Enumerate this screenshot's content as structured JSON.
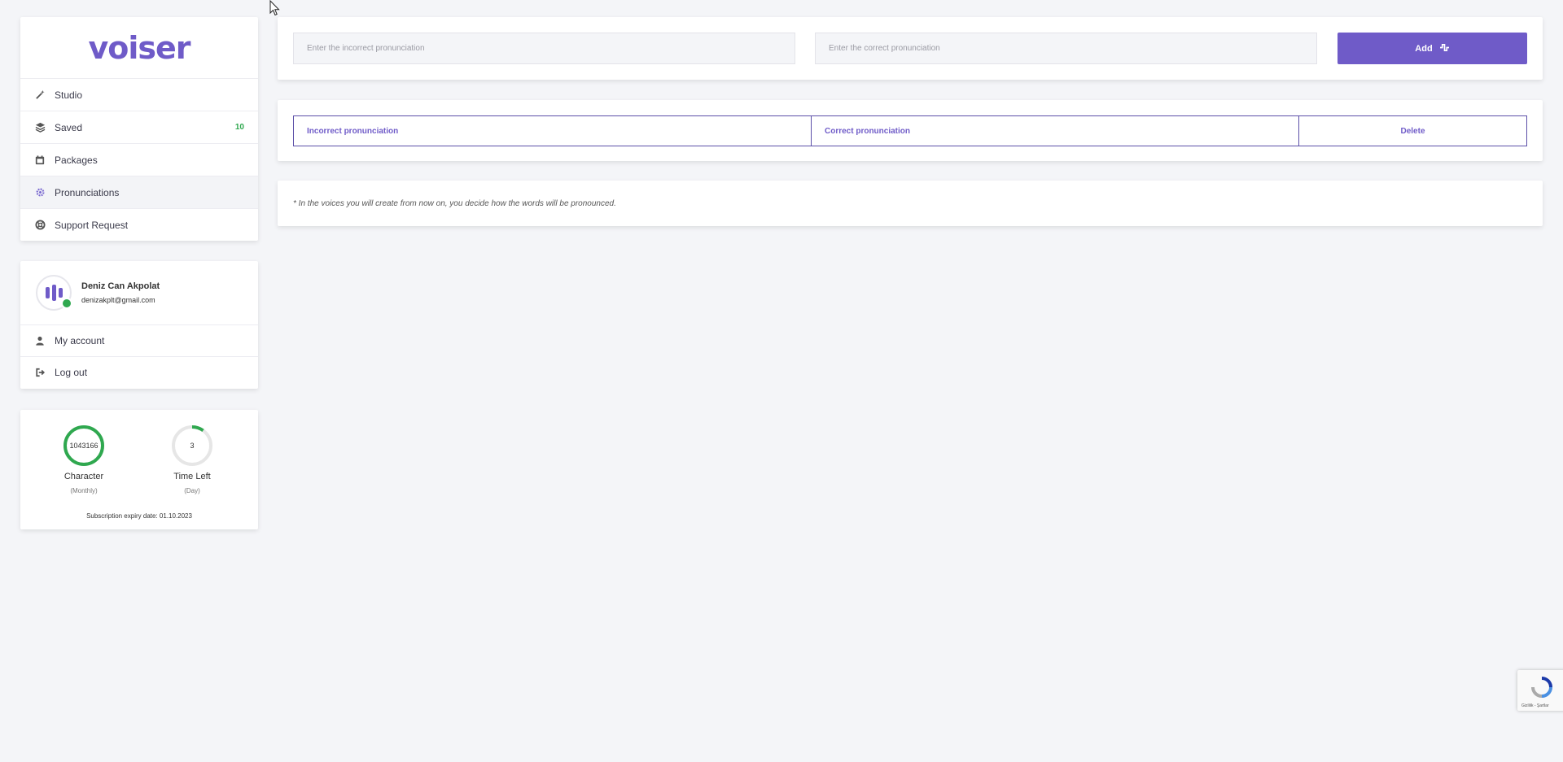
{
  "brand": {
    "logo_text": "voiser",
    "accent": "#6f5bc8",
    "success": "#2fa84f"
  },
  "nav": {
    "items": [
      {
        "label": "Studio",
        "icon": "magic-wand-icon",
        "active": false
      },
      {
        "label": "Saved",
        "icon": "layers-icon",
        "badge": "10",
        "active": false
      },
      {
        "label": "Packages",
        "icon": "calendar-icon",
        "active": false
      },
      {
        "label": "Pronunciations",
        "icon": "gear-icon",
        "active": true
      },
      {
        "label": "Support Request",
        "icon": "life-ring-icon",
        "active": false
      }
    ]
  },
  "user": {
    "name": "Deniz Can Akpolat",
    "email": "denizakplt@gmail.com",
    "status": "online",
    "menu": [
      {
        "label": "My account",
        "icon": "user-icon"
      },
      {
        "label": "Log out",
        "icon": "logout-icon"
      }
    ]
  },
  "stats": {
    "character": {
      "value": "1043166",
      "label": "Character",
      "sub": "(Monthly)",
      "fill": 1.0
    },
    "time_left": {
      "value": "3",
      "label": "Time Left",
      "sub": "(Day)",
      "fill": 0.1
    },
    "expiry": "Subscription expiry date: 01.10.2023"
  },
  "form": {
    "incorrect_placeholder": "Enter the incorrect pronunciation",
    "correct_placeholder": "Enter the correct pronunciation",
    "incorrect_value": "",
    "correct_value": "",
    "add_label": "Add",
    "add_icon": "waveform-icon"
  },
  "table": {
    "headers": [
      "Incorrect pronunciation",
      "Correct pronunciation",
      "Delete"
    ],
    "rows": []
  },
  "note": "* In the voices you will create from now on, you decide how the words will be pronounced.",
  "recaptcha": {
    "text": "Gizlilik - Şartlar"
  }
}
